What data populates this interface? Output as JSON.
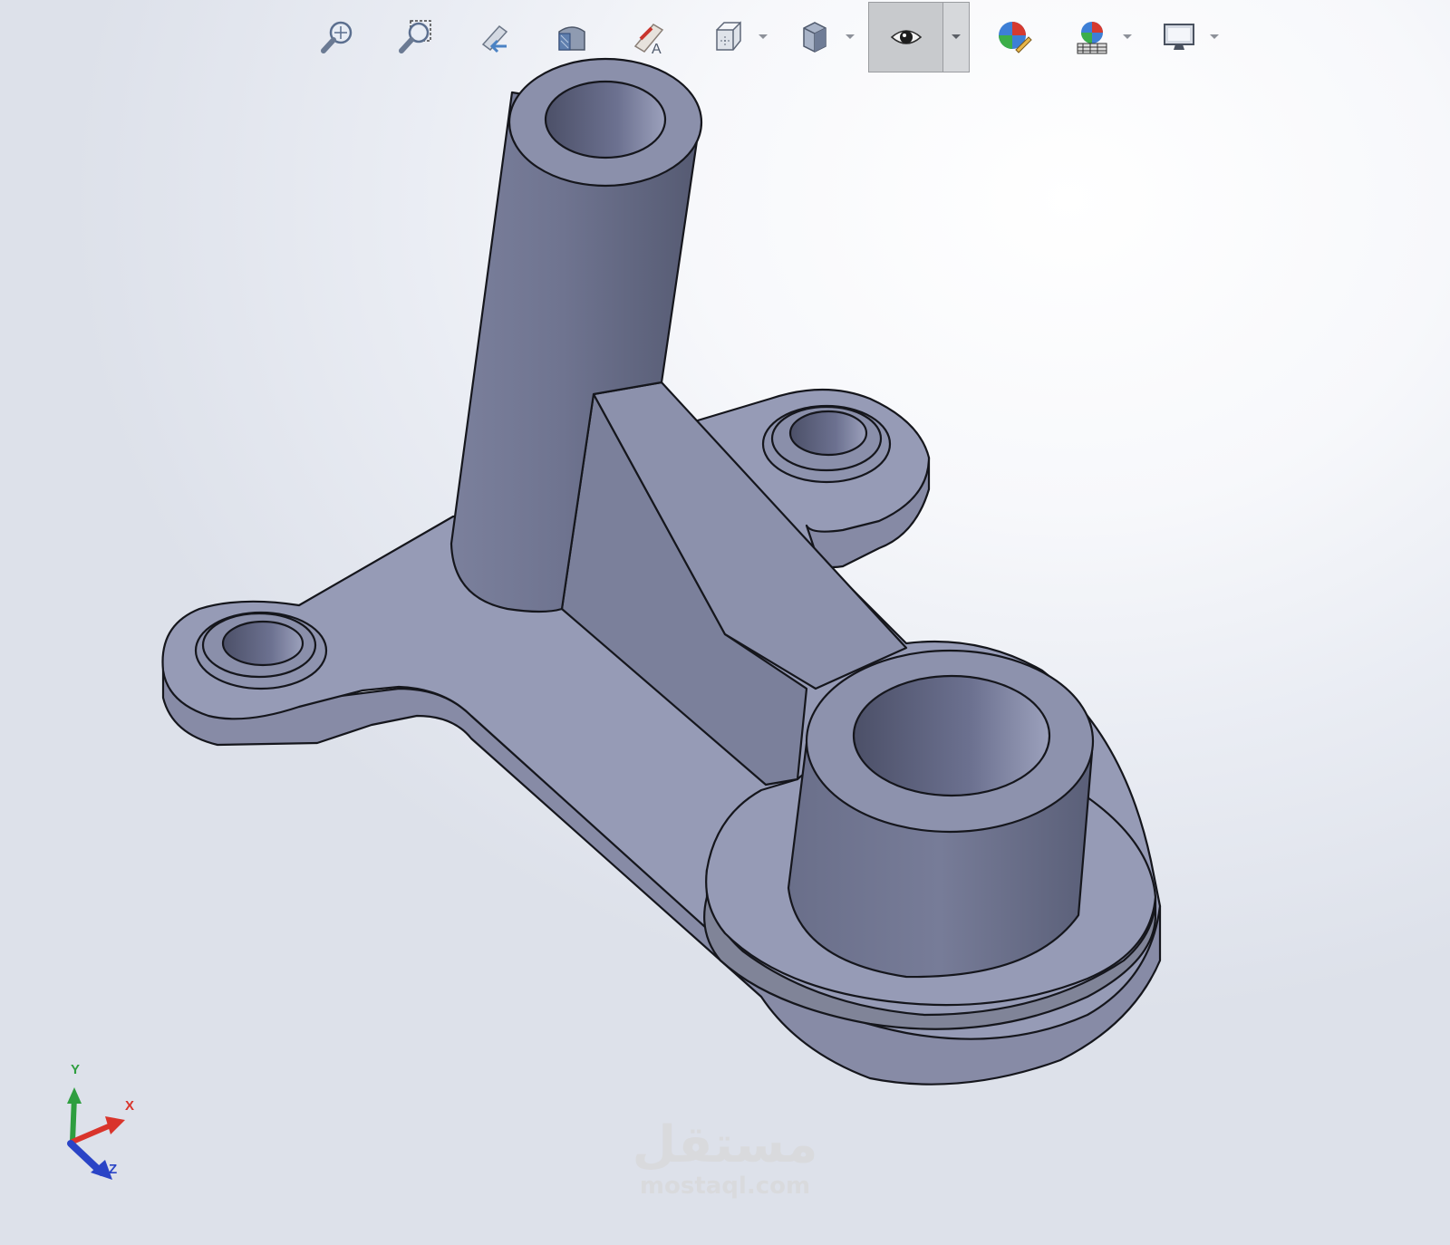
{
  "toolbar": {
    "buttons": [
      {
        "icon": "zoom-to-fit-icon"
      },
      {
        "icon": "zoom-to-area-icon"
      },
      {
        "icon": "previous-view-icon"
      },
      {
        "icon": "section-view-icon"
      },
      {
        "icon": "dynamic-annotation-views-icon"
      },
      {
        "icon": "view-orientation-icon",
        "has_dropdown": true
      },
      {
        "icon": "display-style-icon",
        "has_dropdown": true
      },
      {
        "icon": "hide-show-items-icon",
        "has_dropdown": true,
        "pressed": true
      },
      {
        "icon": "edit-appearance-icon"
      },
      {
        "icon": "apply-scene-icon",
        "has_dropdown": true
      },
      {
        "icon": "view-settings-icon",
        "has_dropdown": true
      }
    ]
  },
  "triad": {
    "x_label": "X",
    "y_label": "Y",
    "z_label": "Z",
    "x_color": "#d9342b",
    "y_color": "#2e9e3f",
    "z_color": "#2a44c6"
  },
  "watermark": {
    "logo": "مستقل",
    "url": "mostaql.com"
  },
  "colors": {
    "part_face": "#959ab5",
    "part_dark": "#6e7390",
    "part_edge": "#15161c",
    "background": "#f4f5f9"
  }
}
